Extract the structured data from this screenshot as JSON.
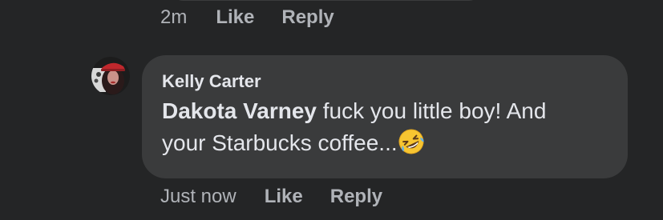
{
  "previous_comment": {
    "timestamp": "2m",
    "like_label": "Like",
    "reply_label": "Reply"
  },
  "comment": {
    "author": "Kelly Carter",
    "mention": "Dakota Varney",
    "text_line1": " fuck you little boy! And",
    "text_line2": "your Starbucks coffee...",
    "emoji_name": "rolling-on-the-floor-laughing-emoji",
    "timestamp": "Just now",
    "like_label": "Like",
    "reply_label": "Reply"
  },
  "colors": {
    "background": "#242526",
    "bubble": "#3a3b3c",
    "primary_text": "#e4e6eb",
    "secondary_text": "#b0b3b8"
  }
}
